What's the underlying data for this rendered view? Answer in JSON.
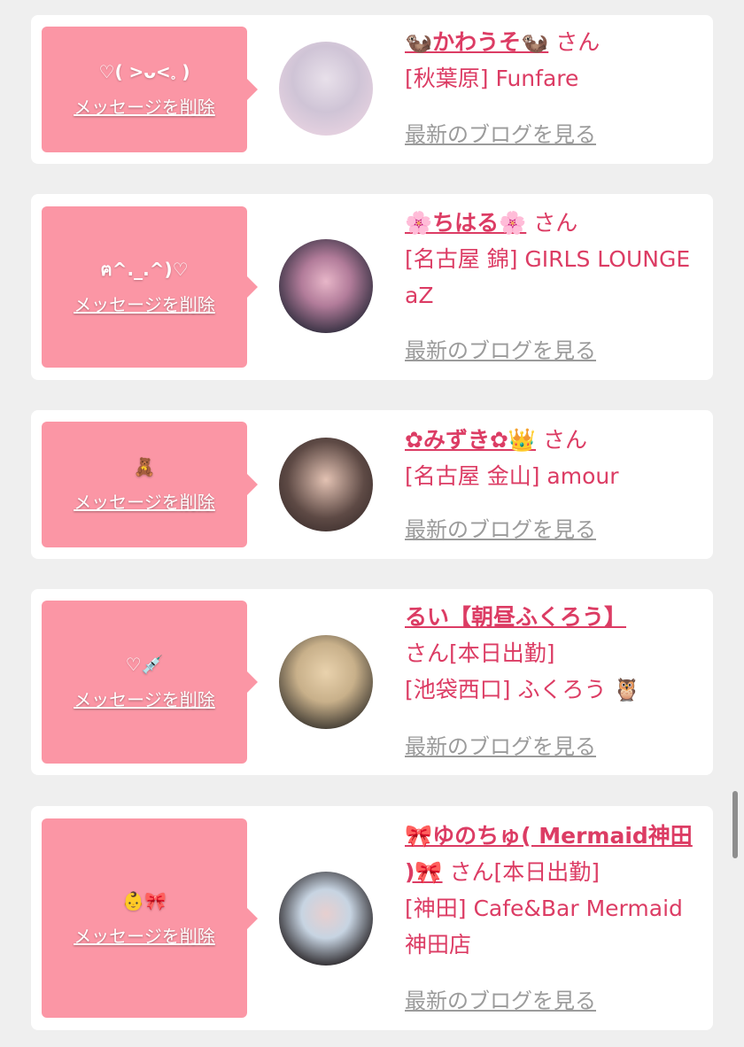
{
  "cards": [
    {
      "message": "♡( >ᴗ<𓈒 )",
      "delete_label": "メッセージを削除",
      "name": "🦦かわうそ🦦",
      "san_suffix": " さん",
      "shop": "[秋葉原] Funfare",
      "blog_label": "最新のブログを見る",
      "avatar_colors": [
        "#f3d9e6",
        "#cfc4d6",
        "#e8e0ea"
      ]
    },
    {
      "message": "ฅ^._.^)♡",
      "delete_label": "メッセージを削除",
      "name": "🌸ちはる🌸",
      "san_suffix": " さん",
      "shop": "[名古屋 錦] GIRLS LOUNGE aZ",
      "blog_label": "最新のブログを見る",
      "avatar_colors": [
        "#2b2a3a",
        "#b27c9a",
        "#e7b6c8"
      ]
    },
    {
      "message": "🧸",
      "delete_label": "メッセージを削除",
      "name": "✿みずき✿👑",
      "san_suffix": " さん",
      "shop": "[名古屋 金山] amour",
      "blog_label": "最新のブログを見る",
      "avatar_colors": [
        "#5e4a45",
        "#e3c2b3",
        "#2a2020"
      ]
    },
    {
      "message": "♡💉",
      "delete_label": "メッセージを削除",
      "name": "るい【朝昼ふくろう】",
      "san_suffix": "さん[本日出勤]",
      "shop": "[池袋西口] ふくろう 🦉",
      "blog_label": "最新のブログを見る",
      "avatar_colors": [
        "#2d2a26",
        "#e9d2ad",
        "#c8b08a"
      ]
    },
    {
      "message": "👶🎀",
      "delete_label": "メッセージを削除",
      "name": "🎀ゆのちゅ( Mermaid神田 )🎀",
      "san_suffix": " さん[本日出勤]",
      "shop": "[神田] Cafe&Bar Mermaid 神田店",
      "blog_label": "最新のブログを見る",
      "avatar_colors": [
        "#1f1a1c",
        "#e7cfcf",
        "#c7d4e2"
      ]
    }
  ],
  "theme": {
    "bubble": "#fb96a5",
    "accent": "#dc3c64",
    "link_gray": "#9b9b9b",
    "background": "#efefef"
  }
}
